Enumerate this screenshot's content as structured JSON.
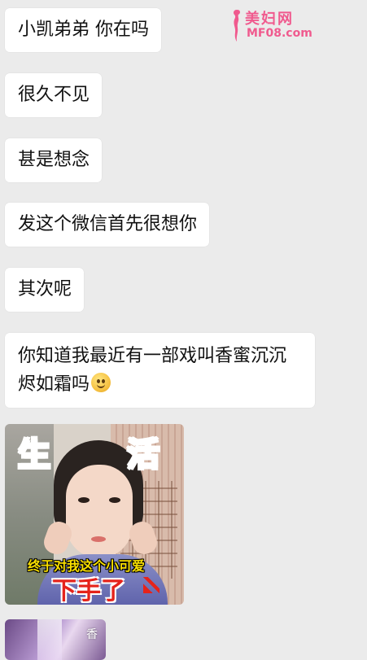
{
  "messages": [
    {
      "text": "小凯弟弟 你在吗"
    },
    {
      "text": "很久不见"
    },
    {
      "text": "甚是想念"
    },
    {
      "text": "发这个微信首先很想你"
    },
    {
      "text": "其次呢"
    },
    {
      "text": "你知道我最近有一部戏叫香蜜沉沉烬如霜吗",
      "emoji": "smile-emoji"
    }
  ],
  "sticker": {
    "word_left": "生",
    "word_right": "活",
    "caption_line1": "终于对我这个小可爱",
    "caption_line2": "下手了"
  },
  "image2": {
    "text": "香"
  },
  "watermark": {
    "title": "美妇网",
    "url": "MF08.com",
    "color": "#f05a8e"
  },
  "colors": {
    "background": "#ebebeb",
    "bubble": "#ffffff"
  }
}
